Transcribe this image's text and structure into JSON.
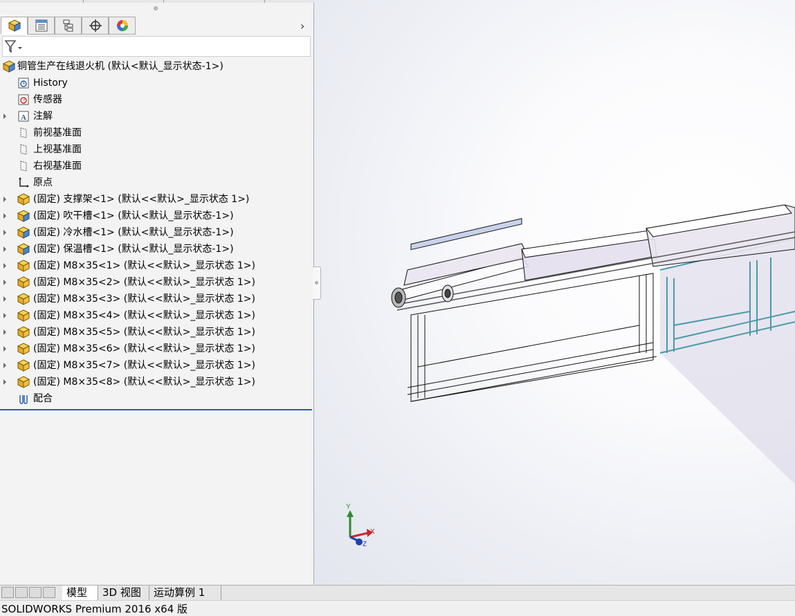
{
  "tabs": [
    {
      "name": "featuremanager",
      "icon": "cube-icon"
    },
    {
      "name": "propertymanager",
      "icon": "property-list-icon"
    },
    {
      "name": "configurationmanager",
      "icon": "configuration-icon"
    },
    {
      "name": "dimxpert",
      "icon": "crosshair-icon"
    },
    {
      "name": "display-manager",
      "icon": "color-wheel-icon"
    }
  ],
  "tree": {
    "root": "铜管生产在线退火机  (默认<默认_显示状态-1>)",
    "items": [
      {
        "label": "History",
        "icon": "history-icon"
      },
      {
        "label": "传感器",
        "icon": "sensor-icon"
      },
      {
        "label": "注解",
        "icon": "annotation-icon"
      },
      {
        "label": "前视基准面",
        "icon": "plane-icon"
      },
      {
        "label": "上视基准面",
        "icon": "plane-icon"
      },
      {
        "label": "右视基准面",
        "icon": "plane-icon"
      },
      {
        "label": "原点",
        "icon": "origin-icon"
      },
      {
        "label": "(固定) 支撑架<1> (默认<<默认>_显示状态 1>)",
        "icon": "part-icon"
      },
      {
        "label": "(固定) 吹干槽<1> (默认<默认_显示状态-1>)",
        "icon": "assembly-icon"
      },
      {
        "label": "(固定) 冷水槽<1> (默认<默认_显示状态-1>)",
        "icon": "assembly-icon"
      },
      {
        "label": "(固定) 保温槽<1> (默认<默认_显示状态-1>)",
        "icon": "assembly-icon"
      },
      {
        "label": "(固定) M8×35<1> (默认<<默认>_显示状态 1>)",
        "icon": "part-icon"
      },
      {
        "label": "(固定) M8×35<2> (默认<<默认>_显示状态 1>)",
        "icon": "part-icon"
      },
      {
        "label": "(固定) M8×35<3> (默认<<默认>_显示状态 1>)",
        "icon": "part-icon"
      },
      {
        "label": "(固定) M8×35<4> (默认<<默认>_显示状态 1>)",
        "icon": "part-icon"
      },
      {
        "label": "(固定) M8×35<5> (默认<<默认>_显示状态 1>)",
        "icon": "part-icon"
      },
      {
        "label": "(固定) M8×35<6> (默认<<默认>_显示状态 1>)",
        "icon": "part-icon"
      },
      {
        "label": "(固定) M8×35<7> (默认<<默认>_显示状态 1>)",
        "icon": "part-icon"
      },
      {
        "label": "(固定) M8×35<8> (默认<<默认>_显示状态 1>)",
        "icon": "part-icon"
      },
      {
        "label": "配合",
        "icon": "mates-icon"
      }
    ]
  },
  "triad": {
    "x": "X",
    "y": "Y",
    "z": "Z"
  },
  "bottom_tabs": [
    "模型",
    "3D 视图",
    "运动算例 1"
  ],
  "status": "SOLIDWORKS Premium 2016 x64 版",
  "colors": {
    "accent": "#2b5fa8",
    "frame": "#6fb9c4",
    "part": "#f3c84b"
  }
}
